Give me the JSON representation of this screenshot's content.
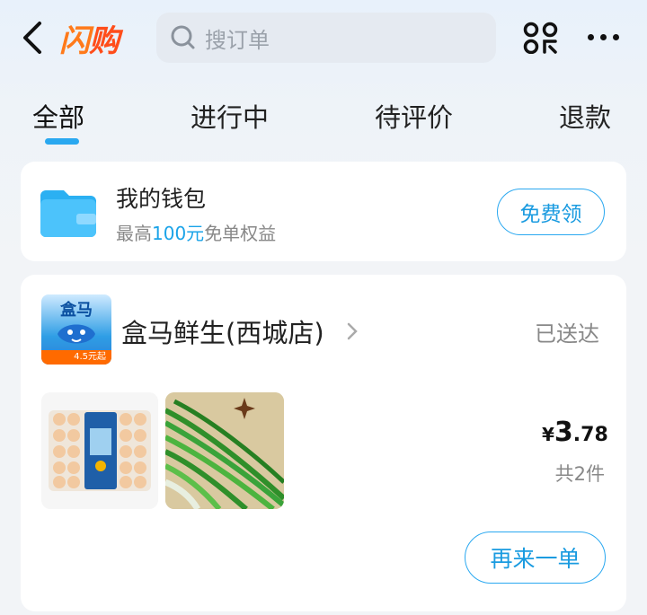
{
  "header": {
    "logo_part1": "闪",
    "logo_part2": "购",
    "search_placeholder": "搜订单"
  },
  "tabs": [
    "全部",
    "进行中",
    "待评价",
    "退款"
  ],
  "wallet": {
    "title": "我的钱包",
    "subtitle_prefix": "最高",
    "subtitle_highlight": "100元",
    "subtitle_suffix": "免单权益",
    "button": "免费领"
  },
  "order": {
    "store_logo_text": "盒马",
    "store_logo_badge": "4.5元起",
    "store_name": "盒马鲜生(西城店)",
    "status": "已送达",
    "price_currency": "¥",
    "price_integer": "3",
    "price_decimal": ".78",
    "item_count": "共2件",
    "reorder_button": "再来一单"
  },
  "colors": {
    "accent": "#1a9be0",
    "logo_orange": "#ff7a1a",
    "tab_indicator": "#2aa8f0"
  },
  "icons": [
    "back-icon",
    "search-icon",
    "scan-icon",
    "more-icon",
    "wallet-icon",
    "chevron-right-icon"
  ]
}
